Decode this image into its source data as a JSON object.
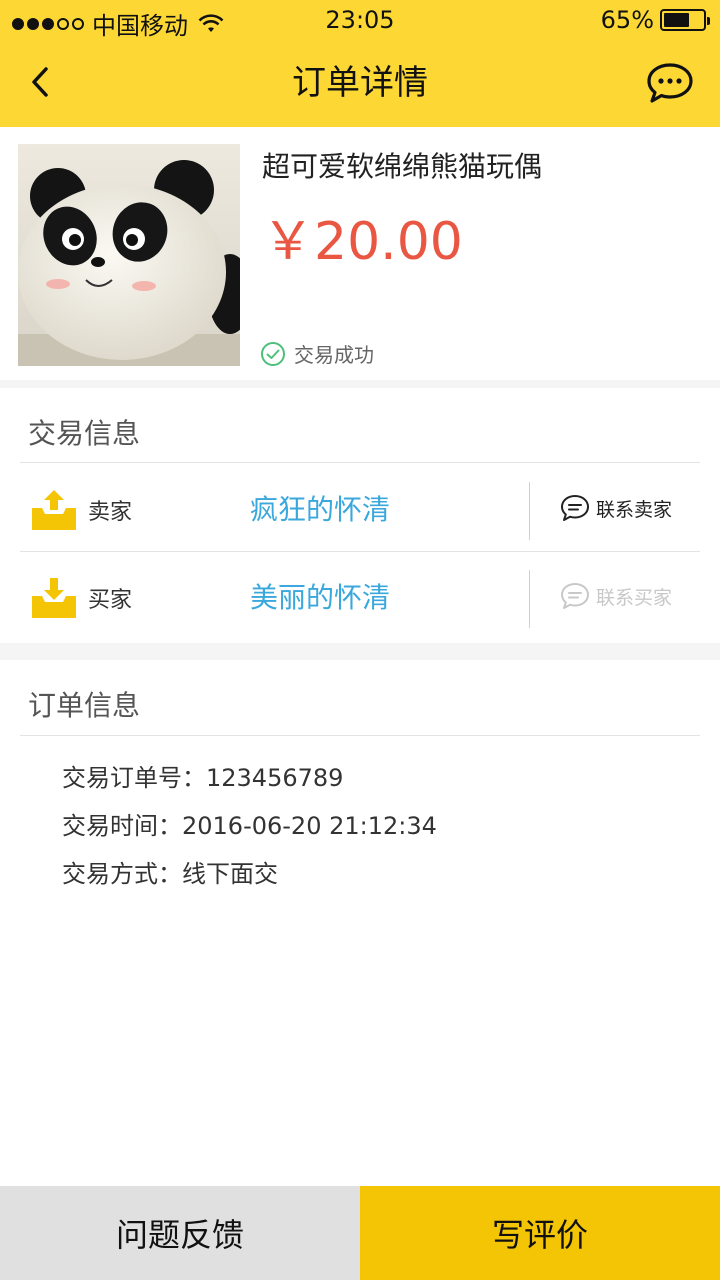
{
  "status_bar": {
    "carrier": "中国移动",
    "time": "23:05",
    "battery": "65%",
    "battery_level": 0.65
  },
  "nav": {
    "title": "订单详情",
    "back_icon": "chevron-left-icon",
    "chat_icon": "chat-bubble-icon"
  },
  "product": {
    "name": "超可爱软绵绵熊猫玩偶",
    "price": "￥20.00",
    "status": "交易成功",
    "status_color": "#4cc07a",
    "price_color": "#e95743"
  },
  "trade_info": {
    "title": "交易信息",
    "seller": {
      "role": "卖家",
      "name": "疯狂的怀清",
      "contact": "联系卖家"
    },
    "buyer": {
      "role": "买家",
      "name": "美丽的怀清",
      "contact": "联系买家"
    },
    "name_color": "#3aa8dc"
  },
  "order_info": {
    "title": "订单信息",
    "lines": [
      "交易订单号：123456789",
      "交易时间：2016-06-20 21:12:34",
      "交易方式：线下面交"
    ]
  },
  "bottom": {
    "feedback_label": "问题反馈",
    "review_label": "写评价"
  },
  "colors": {
    "header": "#fdd835",
    "accent": "#f3c505"
  }
}
